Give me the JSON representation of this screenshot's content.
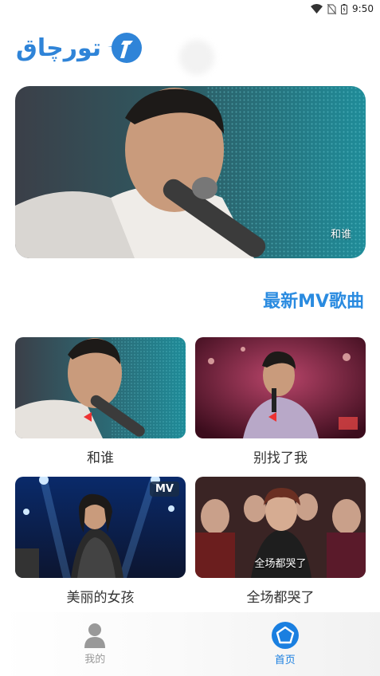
{
  "status_bar": {
    "time": "9:50"
  },
  "header": {
    "logo_text": "تورچاق"
  },
  "banner": {
    "caption": "和谁"
  },
  "section": {
    "title": "最新MV歌曲"
  },
  "videos": [
    {
      "title": "和谁"
    },
    {
      "title": "别找了我"
    },
    {
      "title": "美丽的女孩",
      "badge": "MV"
    },
    {
      "title": "全场都哭了",
      "caption": "全场都哭了"
    }
  ],
  "nav": {
    "mine_label": "我的",
    "home_label": "首页"
  },
  "colors": {
    "accent": "#1a7fe0",
    "section_title": "#2a8be0",
    "inactive": "#999999"
  }
}
